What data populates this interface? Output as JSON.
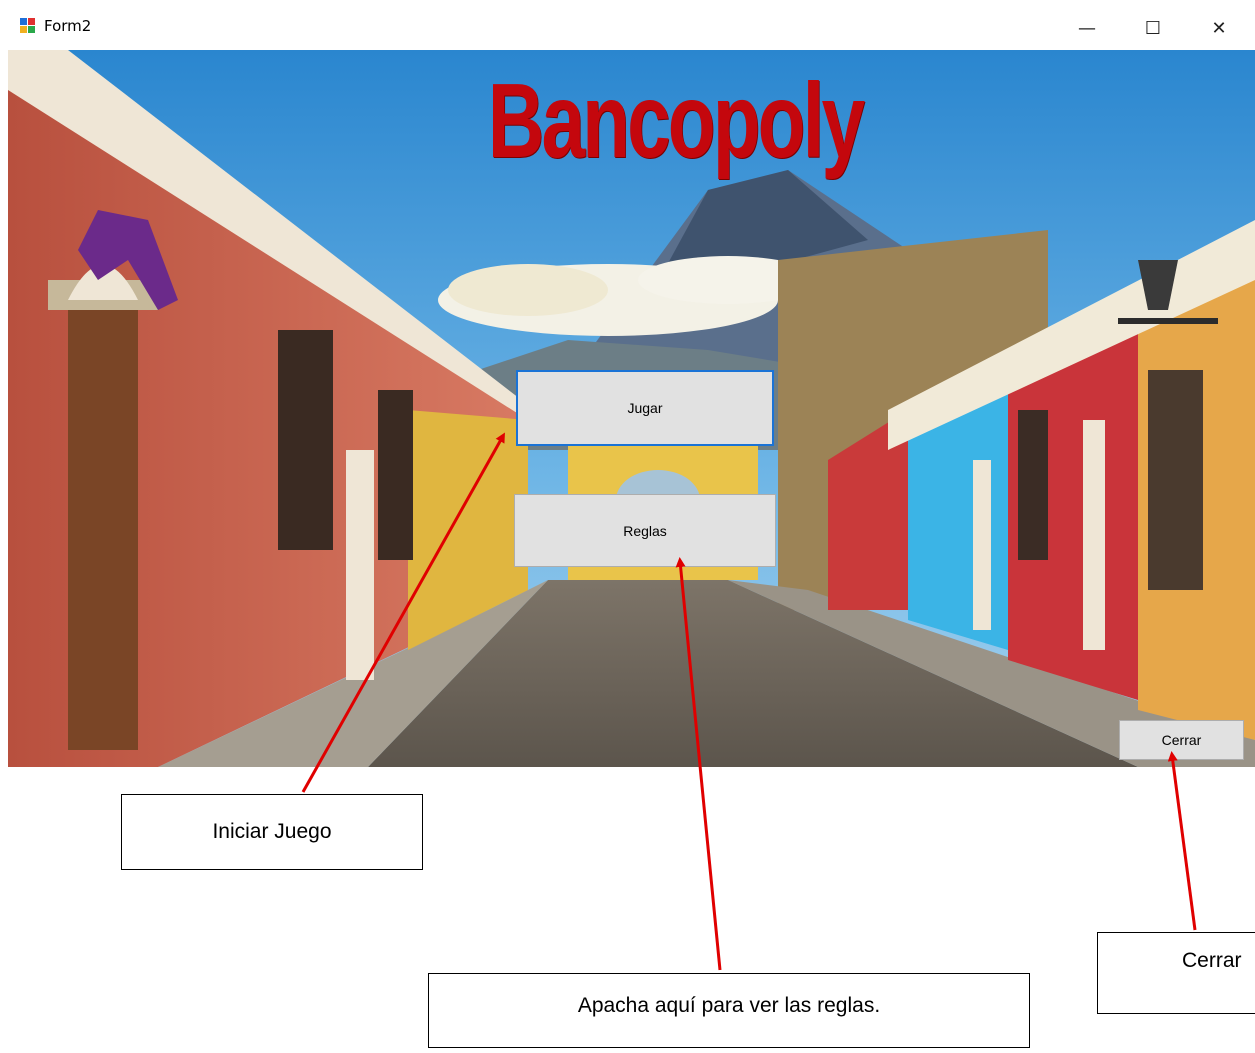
{
  "window": {
    "title": "Form2"
  },
  "main": {
    "logo_text": "Bancopoly",
    "play_button": "Jugar",
    "rules_button": "Reglas",
    "close_button": "Cerrar"
  },
  "callouts": {
    "start_game": "Iniciar Juego",
    "rules": "Apacha aquí para ver las reglas.",
    "close": "Cerrar"
  },
  "colors": {
    "logo": "#c4070d",
    "arrow": "#e00000",
    "focus_border": "#1a73d6"
  }
}
